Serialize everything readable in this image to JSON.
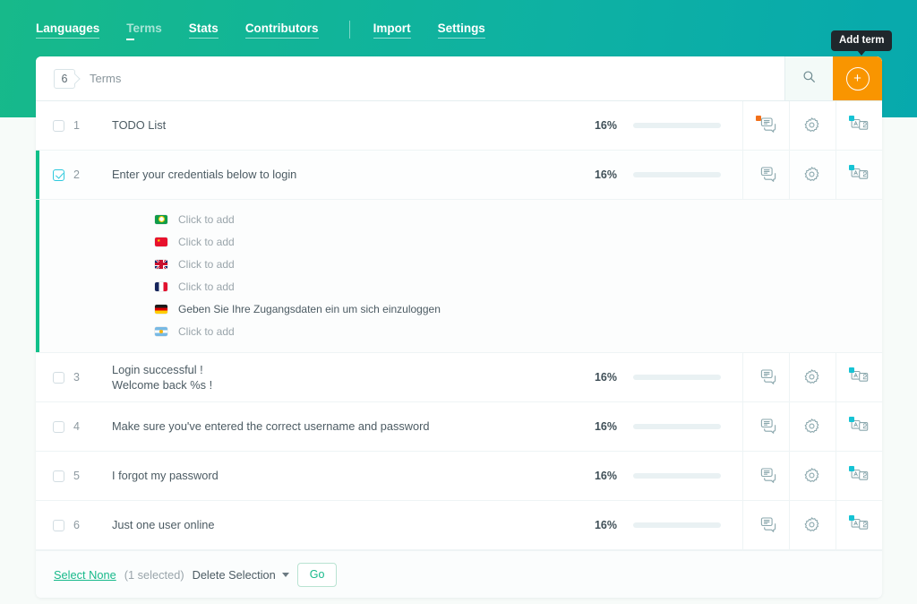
{
  "nav": {
    "items": [
      {
        "label": "Languages",
        "active": false
      },
      {
        "label": "Terms",
        "active": true
      },
      {
        "label": "Stats",
        "active": false
      },
      {
        "label": "Contributors",
        "active": false
      }
    ],
    "items_right": [
      {
        "label": "Import"
      },
      {
        "label": "Settings"
      }
    ]
  },
  "tooltip": {
    "text": "Add term"
  },
  "header": {
    "count": "6",
    "label": "Terms",
    "search_icon": "search-icon",
    "add_icon": "plus-circle-icon",
    "add_color": "#f99500"
  },
  "colors": {
    "accent_green": "#17b98a",
    "accent_teal": "#13c7d8",
    "orange": "#f99500",
    "badge_orange": "#f2701a"
  },
  "rows": [
    {
      "num": "1",
      "checked": false,
      "lines": [
        "TODO List"
      ],
      "pct": "16%",
      "pct_value": 16,
      "comment_badge": "orange",
      "translate_badge": "teal",
      "expanded": false
    },
    {
      "num": "2",
      "checked": true,
      "lines": [
        "Enter your credentials below to login"
      ],
      "pct": "16%",
      "pct_value": 16,
      "comment_badge": "none",
      "translate_badge": "teal",
      "expanded": true,
      "translations": [
        {
          "flag": "br",
          "text": "Click to add",
          "filled": false
        },
        {
          "flag": "cn",
          "text": "Click to add",
          "filled": false
        },
        {
          "flag": "gb",
          "text": "Click to add",
          "filled": false
        },
        {
          "flag": "fr",
          "text": "Click to add",
          "filled": false
        },
        {
          "flag": "de",
          "text": "Geben Sie Ihre Zugangsdaten ein um sich einzuloggen",
          "filled": true
        },
        {
          "flag": "ar",
          "text": "Click to add",
          "filled": false
        }
      ]
    },
    {
      "num": "3",
      "checked": false,
      "lines": [
        "Login successful !",
        "Welcome back %s !"
      ],
      "pct": "16%",
      "pct_value": 16,
      "comment_badge": "none",
      "translate_badge": "teal",
      "expanded": false
    },
    {
      "num": "4",
      "checked": false,
      "lines": [
        "Make sure you've entered the correct username and password"
      ],
      "pct": "16%",
      "pct_value": 16,
      "comment_badge": "none",
      "translate_badge": "teal",
      "expanded": false
    },
    {
      "num": "5",
      "checked": false,
      "lines": [
        "I forgot my password"
      ],
      "pct": "16%",
      "pct_value": 16,
      "comment_badge": "none",
      "translate_badge": "teal",
      "expanded": false
    },
    {
      "num": "6",
      "checked": false,
      "lines": [
        "Just one user online"
      ],
      "pct": "16%",
      "pct_value": 16,
      "comment_badge": "none",
      "translate_badge": "teal",
      "expanded": false
    }
  ],
  "footer": {
    "select_none": "Select None",
    "selected_count": "(1 selected)",
    "action": "Delete Selection",
    "go": "Go"
  }
}
